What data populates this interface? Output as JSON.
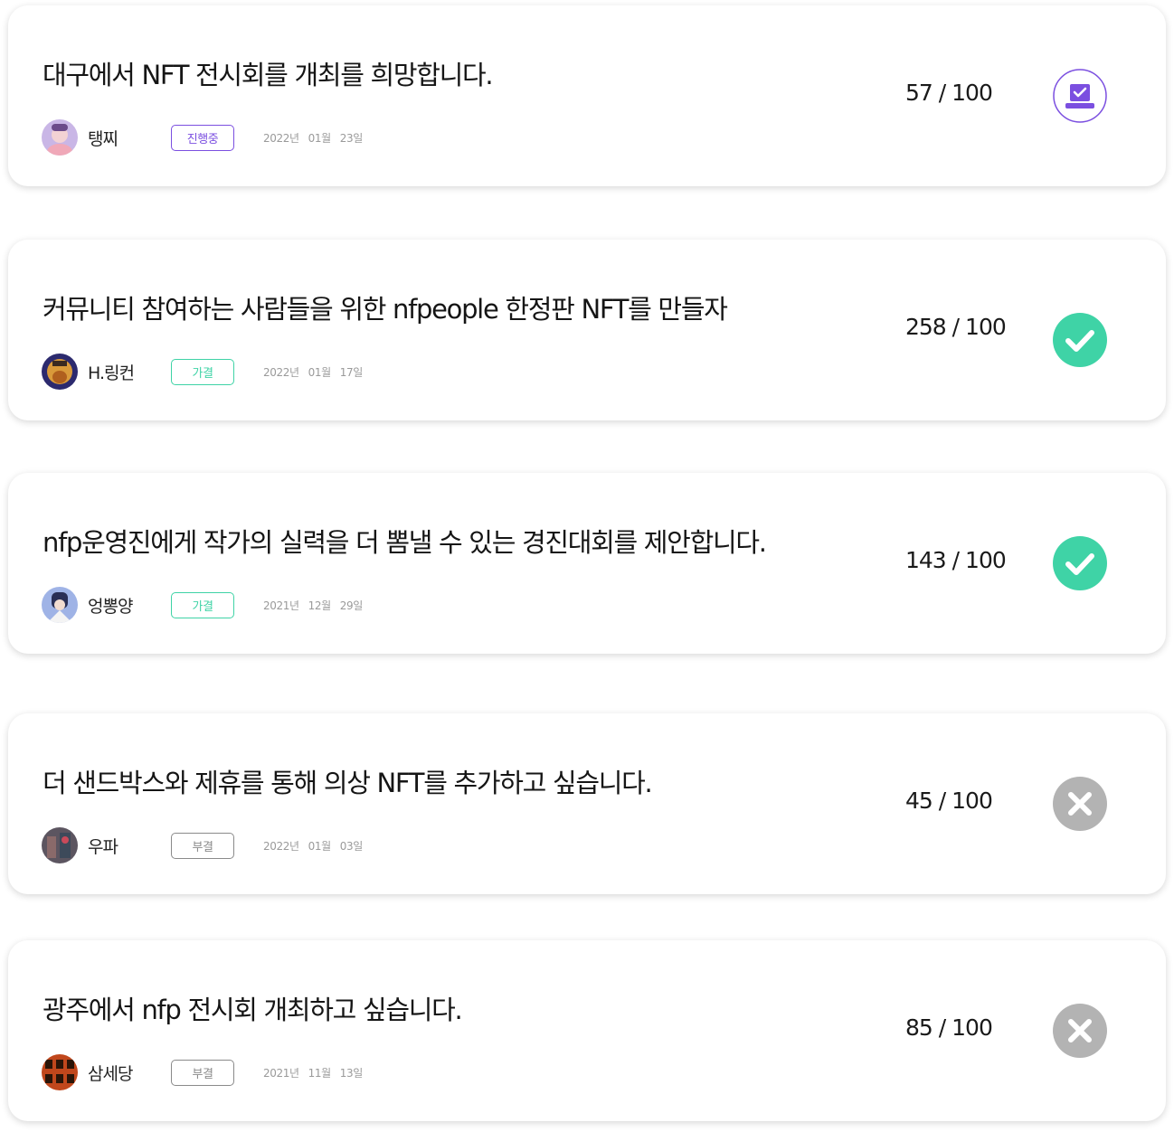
{
  "colors": {
    "ongoing": "#7b4fe0",
    "passed": "#3fd3a6",
    "rejected": "#8a8a8a"
  },
  "proposals": [
    {
      "title": "대구에서 NFT 전시회를 개최를 희망합니다.",
      "author": "탱찌",
      "status": "진행중",
      "date": {
        "year": "2022년",
        "month": "01월",
        "day": "23일"
      },
      "score": "57 / 100",
      "icon": "vote-icon"
    },
    {
      "title": "커뮤니티 참여하는 사람들을 위한 nfpeople 한정판 NFT를 만들자",
      "author": "H.링컨",
      "status": "가결",
      "date": {
        "year": "2022년",
        "month": "01월",
        "day": "17일"
      },
      "score": "258 / 100",
      "icon": "check-icon"
    },
    {
      "title": "nfp운영진에게 작가의 실력을 더 뽐낼 수 있는 경진대회를 제안합니다.",
      "author": "엉뽕양",
      "status": "가결",
      "date": {
        "year": "2021년",
        "month": "12월",
        "day": "29일"
      },
      "score": "143 / 100",
      "icon": "check-icon"
    },
    {
      "title": "더 샌드박스와 제휴를 통해 의상 NFT를 추가하고 싶습니다.",
      "author": "우파",
      "status": "부결",
      "date": {
        "year": "2022년",
        "month": "01월",
        "day": "03일"
      },
      "score": "45 / 100",
      "icon": "x-icon"
    },
    {
      "title": "광주에서 nfp 전시회 개최하고 싶습니다.",
      "author": "삼세당",
      "status": "부결",
      "date": {
        "year": "2021년",
        "month": "11월",
        "day": "13일"
      },
      "score": "85 / 100",
      "icon": "x-icon"
    }
  ]
}
